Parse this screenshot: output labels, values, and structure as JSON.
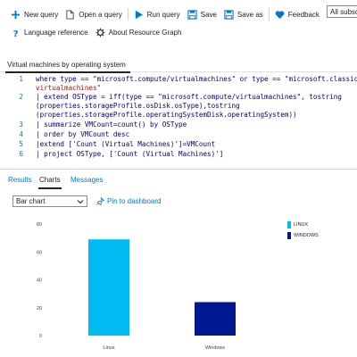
{
  "toolbar": {
    "new_query": "New query",
    "open_query": "Open a query",
    "run_query": "Run query",
    "save": "Save",
    "save_as": "Save as",
    "feedback": "Feedback",
    "subscriptions": "All subscri",
    "language_reference": "Language reference",
    "about_graph": "About Resource Graph"
  },
  "query_tab": {
    "label": "Virtual machines by operating system"
  },
  "editor": {
    "lines": [
      {
        "num": "1",
        "text": "where type == \"microsoft.compute/virtualmachines\" or type == \"microsoft.classiccompu"
      },
      {
        "num": "",
        "text": "virtualmachines\""
      },
      {
        "num": "2",
        "text": "| extend OSType = iff(type == \"microsoft.compute/virtualmachines\", tostring"
      },
      {
        "num": "",
        "text": "(properties.storageProfile.osDisk.osType),tostring"
      },
      {
        "num": "",
        "text": "(properties.storageProfile.operatingSystemDisk.operatingSystem))"
      },
      {
        "num": "3",
        "text": "| summarize VMCount=count() by OSType"
      },
      {
        "num": "4",
        "text": "| order by VMCount desc"
      },
      {
        "num": "5",
        "text": "|extend ['Count (Virtual Machines)']=VMCount"
      },
      {
        "num": "6",
        "text": "| project OSType, ['Count (Virtual Machines)']"
      }
    ]
  },
  "result_tabs": {
    "results": "Results",
    "charts": "Charts",
    "messages": "Messages"
  },
  "chart_type_select": {
    "value": "Bar chart"
  },
  "pin_to_dashboard": "Pin to dashboard",
  "chart_data": {
    "type": "bar",
    "categories": [
      "Linux",
      "Windows"
    ],
    "values": [
      69,
      24
    ],
    "ylim": [
      0,
      80
    ],
    "yticks": [
      0,
      20,
      40,
      60,
      80
    ],
    "colors": [
      "#00bcf2",
      "#00188f"
    ],
    "legend": [
      "LINUX",
      "WINDOWS"
    ],
    "legend_position": "right",
    "grid": false
  }
}
